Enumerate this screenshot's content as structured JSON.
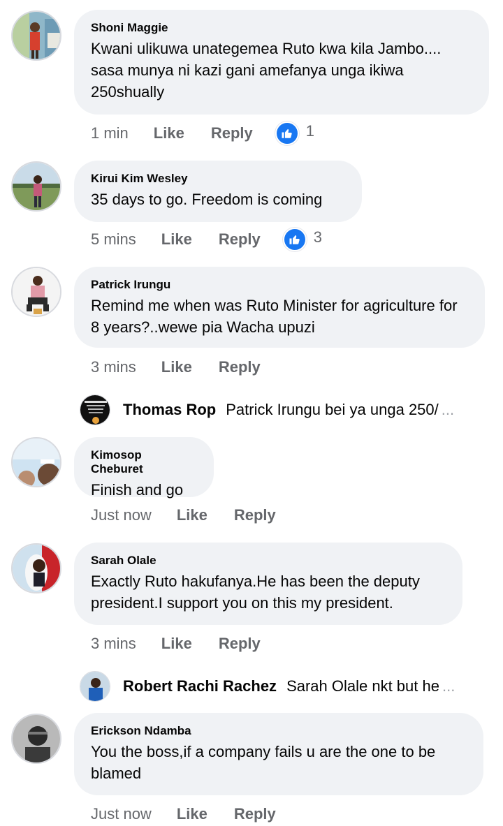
{
  "comments": [
    {
      "author": "Shoni Maggie",
      "text": "Kwani ulikuwa unategemea Ruto kwa kila Jambo.... sasa munya ni kazi gani amefanya unga ikiwa 250shually",
      "time": "1 min",
      "like_label": "Like",
      "reply_label": "Reply",
      "reaction_icon": "thumbs-up-icon",
      "reaction_count": "1"
    },
    {
      "author": "Kirui Kim Wesley",
      "text": "35 days to go. Freedom is coming",
      "time": "5 mins",
      "like_label": "Like",
      "reply_label": "Reply",
      "reaction_icon": "thumbs-up-icon",
      "reaction_count": "3"
    },
    {
      "author": "Patrick Irungu",
      "text": "Remind me when was Ruto Minister for agriculture for 8 years?..wewe pia Wacha upuzi",
      "time": "3 mins",
      "like_label": "Like",
      "reply_label": "Reply",
      "reply_preview": {
        "author": "Thomas Rop",
        "text": "Patrick Irungu bei ya unga 250/",
        "ellipsis": "..."
      }
    },
    {
      "author": "Kimosop Cheburet",
      "text": "Finish and go",
      "time": "Just now",
      "like_label": "Like",
      "reply_label": "Reply"
    },
    {
      "author": "Sarah Olale",
      "text": "Exactly Ruto hakufanya.He has been the deputy president.I support you on this my president.",
      "time": "3 mins",
      "like_label": "Like",
      "reply_label": "Reply",
      "reply_preview": {
        "author": "Robert Rachi Rachez",
        "text": "Sarah Olale nkt but he",
        "ellipsis": "..."
      }
    },
    {
      "author": "Erickson Ndamba",
      "text": "You the boss,if a company fails u are the one to be blamed",
      "time": "Just now",
      "like_label": "Like",
      "reply_label": "Reply"
    }
  ],
  "colors": {
    "bubble": "#f0f2f5",
    "meta_text": "#65676b",
    "like_blue": "#1877f2"
  }
}
